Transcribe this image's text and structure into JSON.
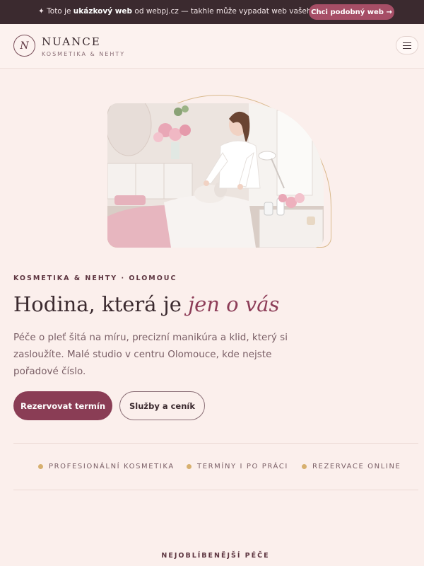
{
  "promo": {
    "prefix": "✦ Toto je ",
    "bold": "ukázkový web",
    "suffix": " od webpj.cz — takhle může vypadat web vašeho studia.",
    "cta": "Chci podobný web →"
  },
  "header": {
    "logo_letter": "N",
    "brand": "NUANCE",
    "tagline": "KOSMETIKA & NEHTY",
    "menu_icon": "hamburger-icon"
  },
  "hero": {
    "image_alt": "Kosmetička ošetřuje pleť klientky v salonu",
    "eyebrow": "KOSMETIKA & NEHTY · OLOMOUC",
    "headline_plain": "Hodina, která je ",
    "headline_accent": "jen o vás",
    "lead": "Péče o pleť šitá na míru, precizní manikúra a klid, který si zasloužíte. Malé studio v centru Olomouce, kde nejste pořadové číslo.",
    "primary_cta": "Rezervovat termín",
    "secondary_cta": "Služby a ceník"
  },
  "features": [
    "PROFESIONÁLNÍ KOSMETIKA",
    "TERMÍNY I PO PRÁCI",
    "REZERVACE ONLINE"
  ],
  "next_section": {
    "eyebrow": "NEJOBLÍBENĚJŠÍ PÉČE"
  },
  "colors": {
    "background": "#fbefec",
    "promo_bg": "#3b2a2f",
    "accent": "#8a3d55",
    "gold": "#d7b06f"
  }
}
